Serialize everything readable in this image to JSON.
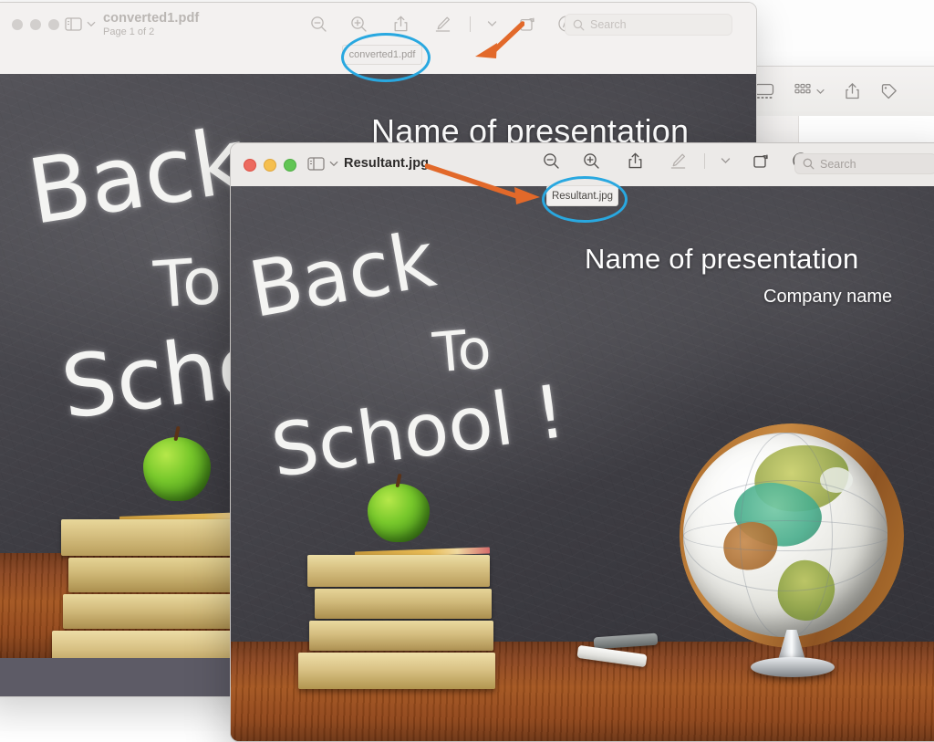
{
  "app": "Preview",
  "finder_window": {
    "name": "finder-window",
    "toolbar_icons": [
      "gallery-view-icon",
      "group-by-icon",
      "chevron-down-icon",
      "share-icon",
      "tag-icon"
    ]
  },
  "back_window": {
    "title": "converted1.pdf",
    "subtitle": "Page 1 of 2",
    "active": false,
    "sidebar_icon": "sidebar-toggle-icon",
    "sidebar_chevron": "chevron-down-icon",
    "toolbar_icons": [
      "zoom-out-icon",
      "zoom-in-icon",
      "share-icon",
      "markup-icon",
      "chevron-down-icon",
      "rotate-icon",
      "annotate-icon"
    ],
    "search": {
      "placeholder": "Search",
      "value": "",
      "icon": "search-icon"
    },
    "tooltip_label": "converted1.pdf"
  },
  "front_window": {
    "title": "Resultant.jpg",
    "active": true,
    "sidebar_icon": "sidebar-toggle-icon",
    "sidebar_chevron": "chevron-down-icon",
    "toolbar_icons": [
      "zoom-out-icon",
      "zoom-in-icon",
      "share-icon",
      "markup-icon",
      "chevron-down-icon",
      "rotate-icon",
      "annotate-icon"
    ],
    "search": {
      "placeholder": "Search",
      "value": "",
      "icon": "search-icon"
    },
    "tooltip_label": "Resultant.jpg"
  },
  "slide": {
    "presentation_title": "Name of presentation",
    "company_name": "Company name",
    "chalk_line_1": "Back",
    "chalk_line_2": "To",
    "chalk_line_3": "School !",
    "objects": [
      "chalkboard",
      "stacked-books",
      "green-apple",
      "pencil",
      "world-globe",
      "chalk-sticks",
      "wooden-table"
    ]
  },
  "annotations": {
    "ellipse_color": "#29a8e0",
    "arrow_color": "#e2692a",
    "items": [
      {
        "name": "annotation-ellipse-converted1",
        "target": "converted1.pdf"
      },
      {
        "name": "annotation-arrow-converted1",
        "direction": "left"
      },
      {
        "name": "annotation-ellipse-resultant",
        "target": "Resultant.jpg"
      },
      {
        "name": "annotation-arrow-resultant",
        "direction": "right"
      }
    ]
  }
}
